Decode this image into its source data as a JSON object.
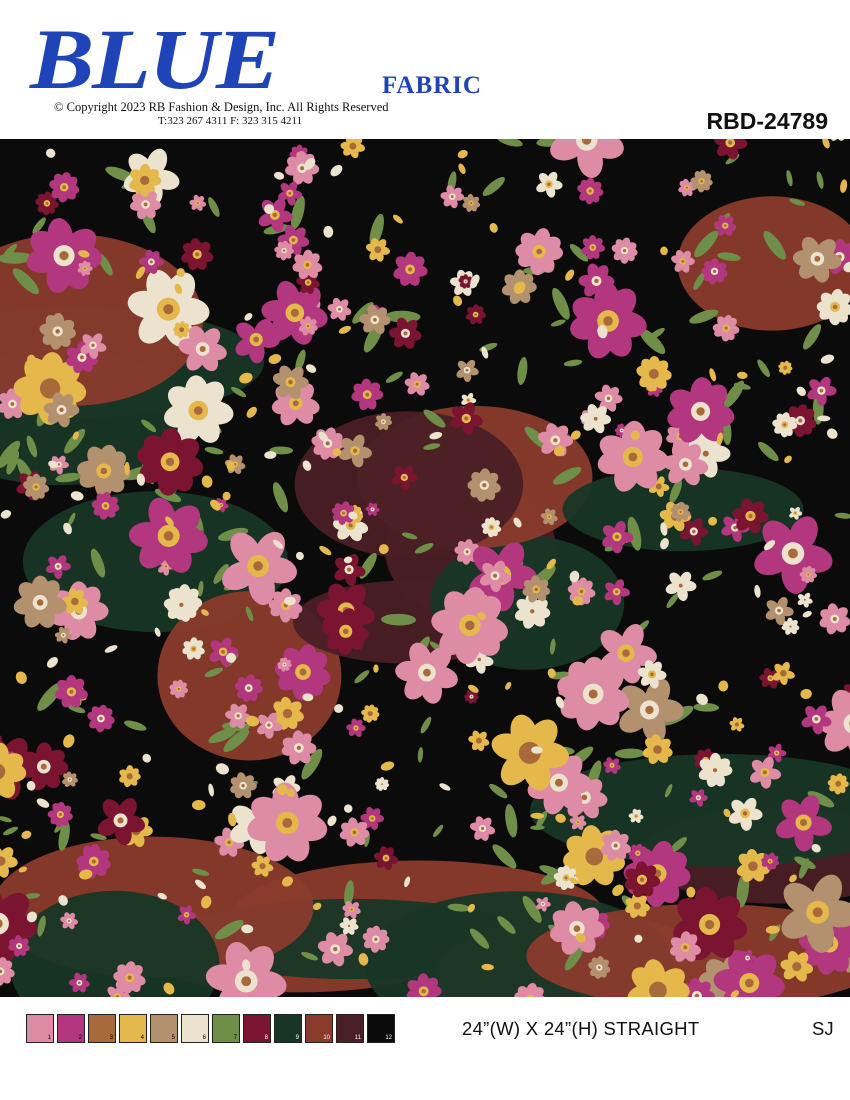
{
  "header": {
    "logo_main": "BLUE",
    "logo_sub": "FABRIC",
    "logo_color": "#1f44b8",
    "copyright": "© Copyright  2023 RB Fashion & Design, Inc. All Rights Reserved",
    "phones": "T:323 267 4311  F: 323 315 4211",
    "design_code": "RBD-24789"
  },
  "pattern": {
    "description_icon": "floral-print",
    "palette": [
      "#de8ba6",
      "#b2377f",
      "#a86a3a",
      "#e5b84b",
      "#b3916e",
      "#ece3cf",
      "#6f8f48",
      "#7a1431",
      "#183626",
      "#8a3b2c",
      "#4a1f25",
      "#0b0b0b"
    ]
  },
  "footer": {
    "swatches": [
      {
        "number": "1",
        "color": "#de8ba6"
      },
      {
        "number": "2",
        "color": "#b2377f"
      },
      {
        "number": "3",
        "color": "#a86a3a"
      },
      {
        "number": "4",
        "color": "#e5b84b"
      },
      {
        "number": "5",
        "color": "#b3916e"
      },
      {
        "number": "6",
        "color": "#ece3cf"
      },
      {
        "number": "7",
        "color": "#6f8f48"
      },
      {
        "number": "8",
        "color": "#7a1431"
      },
      {
        "number": "9",
        "color": "#183626"
      },
      {
        "number": "10",
        "color": "#8a3b2c"
      },
      {
        "number": "11",
        "color": "#4a1f25"
      },
      {
        "number": "12",
        "color": "#0b0b0b"
      }
    ],
    "repeat_size": "24”(W) X 24”(H) STRAIGHT",
    "base": "SJ"
  }
}
